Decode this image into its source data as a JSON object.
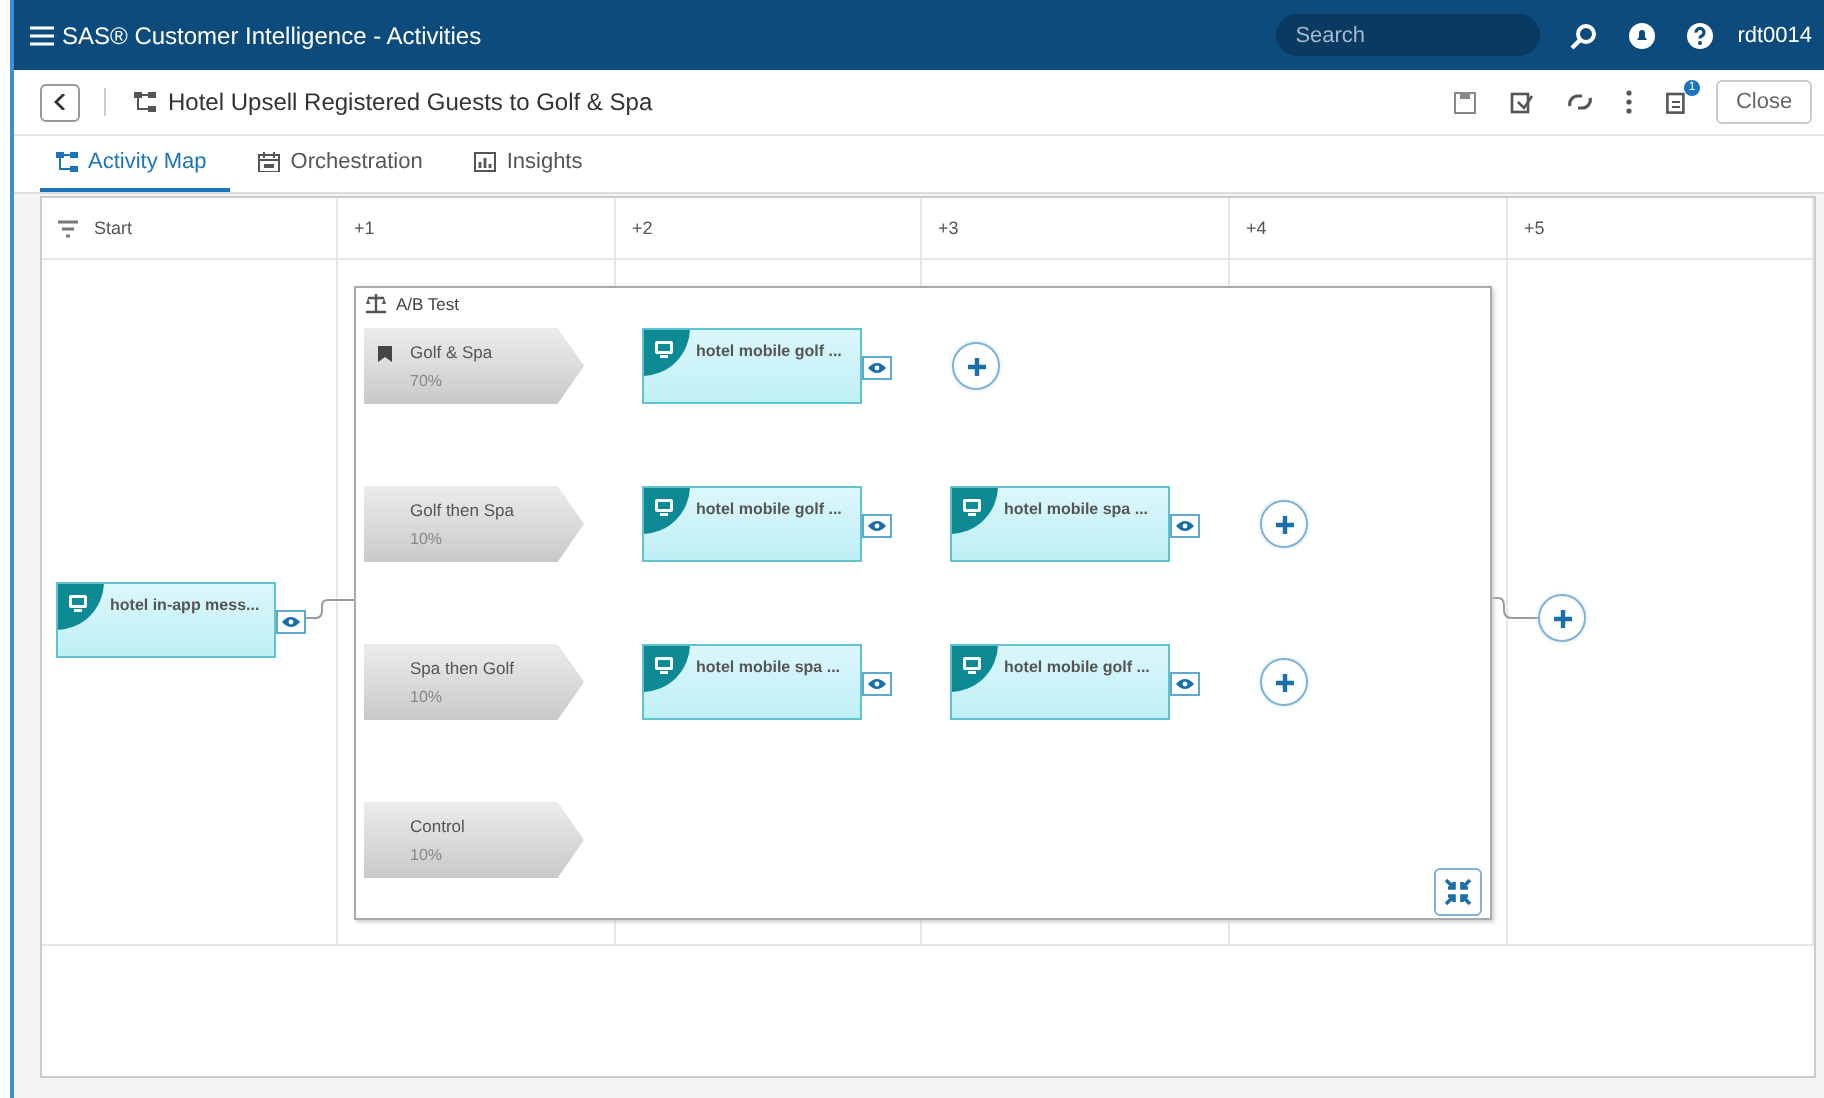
{
  "app_bar": {
    "title": "SAS® Customer Intelligence - Activities",
    "search": {
      "placeholder": "Search"
    },
    "user": "rdt0014"
  },
  "toolbar": {
    "title": "Hotel Upsell Registered Guests to Golf & Spa",
    "badge": "1",
    "close_button": "Close"
  },
  "tabs": [
    {
      "label": "Activity Map",
      "selected": true
    },
    {
      "label": "Orchestration",
      "selected": false
    },
    {
      "label": "Insights",
      "selected": false
    }
  ],
  "columns": [
    "Start",
    "+1",
    "+2",
    "+3",
    "+4",
    "+5"
  ],
  "start_node": {
    "label": "hotel in-app mess..."
  },
  "ab_test": {
    "label": "A/B Test",
    "arms": [
      {
        "name": "Golf & Spa",
        "share": "70%",
        "marked": true,
        "nodes": [
          "hotel mobile golf ..."
        ]
      },
      {
        "name": "Golf then Spa",
        "share": "10%",
        "marked": false,
        "nodes": [
          "hotel mobile golf ...",
          "hotel mobile spa ..."
        ]
      },
      {
        "name": "Spa then Golf",
        "share": "10%",
        "marked": false,
        "nodes": [
          "hotel mobile spa ...",
          "hotel mobile golf ..."
        ]
      },
      {
        "name": "Control",
        "share": "10%",
        "marked": false
      }
    ]
  }
}
